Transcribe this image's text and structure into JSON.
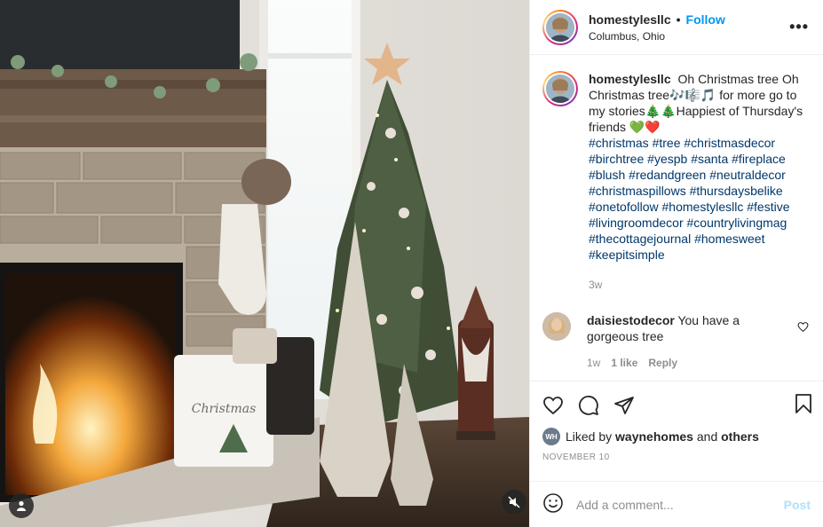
{
  "post": {
    "username": "homestylesllc",
    "location": "Columbus, Ohio",
    "follow_label": "Follow",
    "separator": "•",
    "more_label": "•••"
  },
  "caption": {
    "username": "homestylesllc",
    "text": "Oh Christmas tree Oh Christmas tree🎶🎼🎵 for more go to my stories🎄🎄Happiest of Thursday's friends 💚❤️",
    "hashtags": [
      "#christmas",
      "#tree",
      "#christmasdecor",
      "#birchtree",
      "#yespb",
      "#santa",
      "#fireplace",
      "#blush",
      "#redandgreen",
      "#neutraldecor",
      "#christmaspillows",
      "#thursdaysbelike",
      "#onetofollow",
      "#homestylesllc",
      "#festive",
      "#livingroomdecor",
      "#countrylivingmag",
      "#thecottagejournal",
      "#homesweet",
      "#keepitsimple"
    ],
    "age": "3w"
  },
  "comment": {
    "username": "daisiestodecor",
    "text": "You have a gorgeous tree",
    "age": "1w",
    "likes": "1 like",
    "reply": "Reply"
  },
  "likes": {
    "badge": "WH",
    "prefix": "Liked by",
    "user": "waynehomes",
    "and": "and",
    "others": "others"
  },
  "date": "NOVEMBER 10",
  "add_comment": {
    "placeholder": "Add a comment...",
    "post_label": "Post"
  },
  "media": {
    "pillow_text": "Christmas"
  },
  "icons": {
    "heart": "heart-icon",
    "comment": "comment-icon",
    "share": "share-icon",
    "save": "bookmark-icon",
    "emoji": "emoji-icon",
    "user_tag": "user-tag-icon",
    "mute": "muted-speaker-icon"
  },
  "colors": {
    "follow": "#0095f6",
    "hashtag": "#00376b",
    "muted_text": "#8e8e8e",
    "post_disabled": "#b2dffc"
  }
}
